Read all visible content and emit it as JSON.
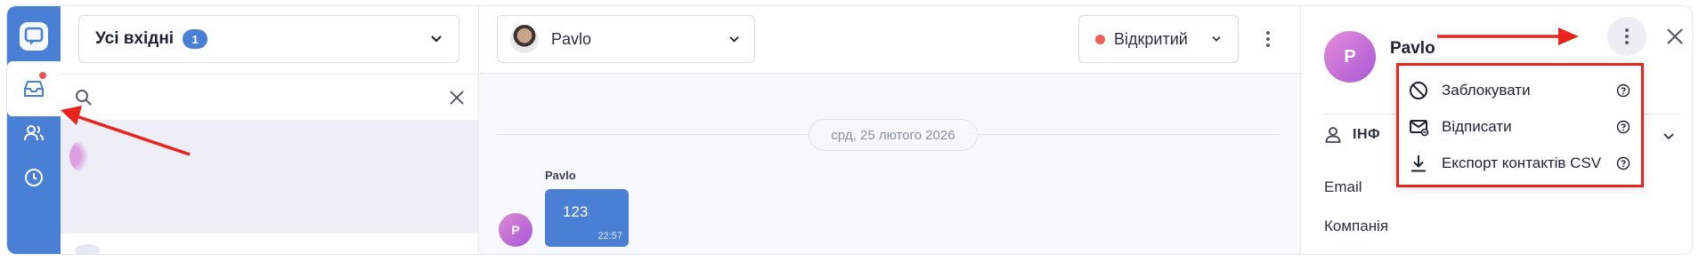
{
  "colors": {
    "accent": "#4a7fd6",
    "status_open": "#f0605c",
    "annotation": "#e8231c",
    "notification": "#f0525c"
  },
  "rail": {
    "items": [
      {
        "name": "inbox",
        "icon": "inbox-icon",
        "active": true,
        "has_notification": true
      },
      {
        "name": "contacts",
        "icon": "contacts-icon",
        "active": false
      },
      {
        "name": "history",
        "icon": "clock-icon",
        "active": false
      }
    ]
  },
  "inbox": {
    "selected": "Усі вхідні",
    "count": "1",
    "search_placeholder": ""
  },
  "chat": {
    "agent_name": "Pavlo",
    "status_label": "Відкритий",
    "date_separator": "срд, 25 лютого 2026",
    "message": {
      "sender": "Pavlo",
      "avatar_initial": "P",
      "text": "123",
      "time": "22:57"
    }
  },
  "contact_panel": {
    "name": "Pavlo",
    "avatar_initial": "P",
    "info_section_label": "ІНФ",
    "fields": [
      "Email",
      "Компанія"
    ]
  },
  "dropdown_menu": {
    "items": [
      {
        "label": "Заблокувати",
        "icon": "block-icon"
      },
      {
        "label": "Відписати",
        "icon": "unsubscribe-mail-icon"
      },
      {
        "label": "Експорт контактів CSV",
        "icon": "download-icon"
      }
    ]
  }
}
